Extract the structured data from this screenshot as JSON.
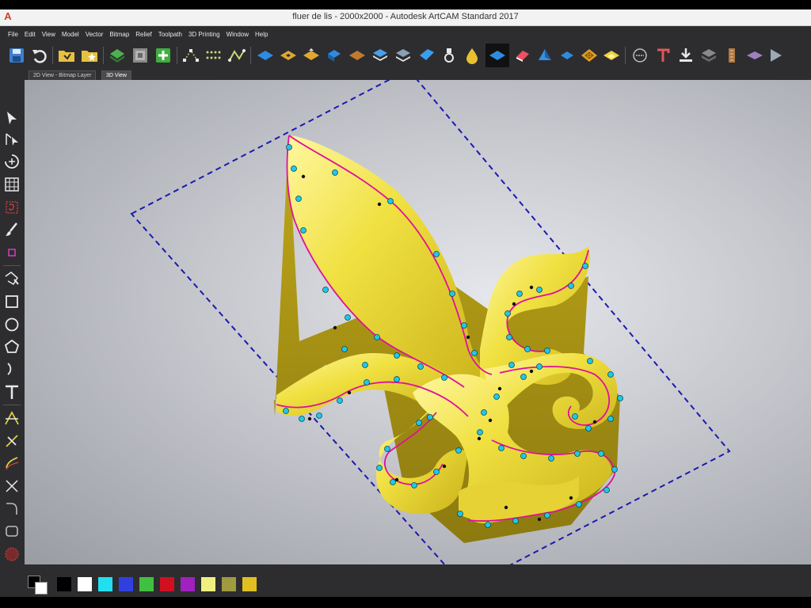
{
  "window": {
    "title": "fluer de lis - 2000x2000 - Autodesk ArtCAM Standard 2017",
    "logo": "A"
  },
  "menu": [
    "File",
    "Edit",
    "View",
    "Model",
    "Vector",
    "Bitmap",
    "Relief",
    "Toolpath",
    "3D Printing",
    "Window",
    "Help"
  ],
  "tabs": {
    "bitmap": "2D View - Bitmap Layer",
    "view3d": "3D View"
  },
  "toolbar_icons": [
    "save-icon",
    "undo-icon",
    "open-folder-icon",
    "new-model-icon",
    "import-relief-icon",
    "bitmap-icon",
    "add-relief-icon",
    "node-editing-icon",
    "smooth-nodes-icon",
    "fit-curve-icon",
    "view-top-icon",
    "view-iso-front-icon",
    "view-iso-left-icon",
    "view-iso-right-icon",
    "view-iso-back-icon",
    "layer-stack-icon",
    "relief-layers-icon",
    "flat-plane-icon",
    "material-icon",
    "drop-icon",
    "shaded-relief-icon",
    "eraser-icon",
    "sculpt-icon",
    "view-plane-icon",
    "texture-icon",
    "lighting-icon",
    "measure-icon",
    "text-tool-icon",
    "export-icon",
    "layers-3d-icon",
    "stitch-icon",
    "flatten-icon",
    "play-icon"
  ],
  "left_tools": [
    "select-arrow-icon",
    "node-edit-icon",
    "transform-icon",
    "grid-icon",
    "bitmap-select-icon",
    "paint-brush-icon",
    "color-fill-icon",
    "polyline-icon",
    "rectangle-icon",
    "circle-icon",
    "polygon-icon",
    "arc-icon",
    "text-icon",
    "vector-offset-icon",
    "node-join-icon",
    "bend-icon",
    "weld-icon",
    "fillet-icon",
    "rounded-rect-icon",
    "sphere-icon"
  ],
  "palette": {
    "primary": "#000000",
    "secondary": "#ffffff",
    "colors": [
      "#000000",
      "#ffffff",
      "#20e0f0",
      "#3040e0",
      "#40c040",
      "#d01020",
      "#a020c0",
      "#f0f080",
      "#a09a40",
      "#e0c020"
    ]
  },
  "model": {
    "relief_color": "#e8d830",
    "vector_color": "#e0109a",
    "node_color": "#20c8e8",
    "bounds_color": "#1a1ab0"
  }
}
